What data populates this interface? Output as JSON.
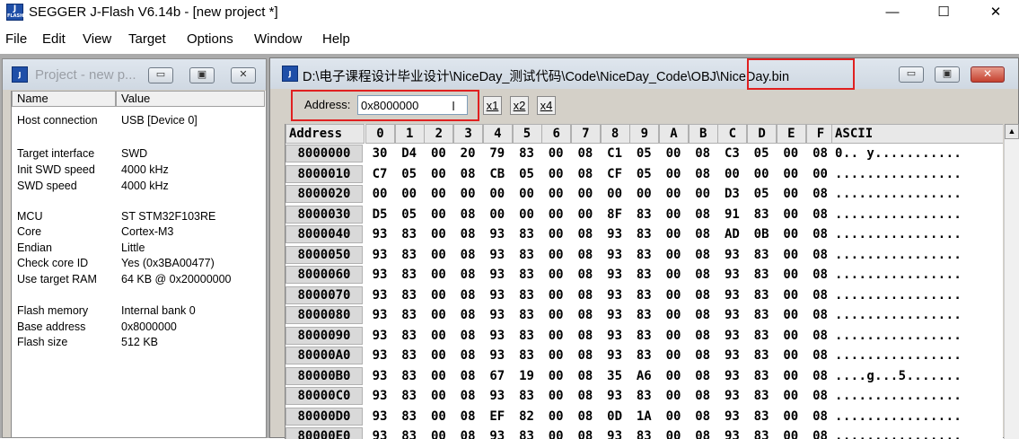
{
  "window": {
    "title": "SEGGER J-Flash V6.14b - [new project *]",
    "icon_text": "J",
    "icon_sub": "FLASH",
    "minimize": "—",
    "maximize": "☐",
    "close": "✕"
  },
  "menu": [
    "File",
    "Edit",
    "View",
    "Target",
    "Options",
    "Window",
    "Help"
  ],
  "project": {
    "title": "Project - new p...",
    "headers": {
      "name": "Name",
      "value": "Value"
    },
    "rows": [
      {
        "name": "Host connection",
        "value": "USB [Device 0]"
      },
      {
        "name": "Target interface",
        "value": "SWD"
      },
      {
        "name": "Init SWD speed",
        "value": "4000 kHz"
      },
      {
        "name": "SWD speed",
        "value": "4000 kHz"
      },
      {
        "name": "MCU",
        "value": "ST STM32F103RE"
      },
      {
        "name": "Core",
        "value": "Cortex-M3"
      },
      {
        "name": "Endian",
        "value": "Little"
      },
      {
        "name": "Check core ID",
        "value": "Yes (0x3BA00477)"
      },
      {
        "name": "Use target RAM",
        "value": "64 KB @ 0x20000000"
      },
      {
        "name": "Flash memory",
        "value": "Internal bank 0"
      },
      {
        "name": "Base address",
        "value": "0x8000000"
      },
      {
        "name": "Flash size",
        "value": "512 KB"
      }
    ]
  },
  "hexview": {
    "path_prefix": "D:\\电子课程设计毕业设计\\NiceDay_测试代码\\Code\\NiceDay_Code\\OBJ\\",
    "file_name": "NiceDay.bin",
    "address_label": "Address:",
    "address_value": "0x8000000",
    "zoom": [
      "x1",
      "x2",
      "x4"
    ],
    "columns": {
      "address": "Address",
      "bytes": [
        "0",
        "1",
        "2",
        "3",
        "4",
        "5",
        "6",
        "7",
        "8",
        "9",
        "A",
        "B",
        "C",
        "D",
        "E",
        "F"
      ],
      "ascii": "ASCII"
    },
    "rows": [
      {
        "addr": "8000000",
        "bytes": [
          "30",
          "D4",
          "00",
          "20",
          "79",
          "83",
          "00",
          "08",
          "C1",
          "05",
          "00",
          "08",
          "C3",
          "05",
          "00",
          "08"
        ],
        "ascii": "0.. y..........."
      },
      {
        "addr": "8000010",
        "bytes": [
          "C7",
          "05",
          "00",
          "08",
          "CB",
          "05",
          "00",
          "08",
          "CF",
          "05",
          "00",
          "08",
          "00",
          "00",
          "00",
          "00"
        ],
        "ascii": "................"
      },
      {
        "addr": "8000020",
        "bytes": [
          "00",
          "00",
          "00",
          "00",
          "00",
          "00",
          "00",
          "00",
          "00",
          "00",
          "00",
          "00",
          "D3",
          "05",
          "00",
          "08"
        ],
        "ascii": "................"
      },
      {
        "addr": "8000030",
        "bytes": [
          "D5",
          "05",
          "00",
          "08",
          "00",
          "00",
          "00",
          "00",
          "8F",
          "83",
          "00",
          "08",
          "91",
          "83",
          "00",
          "08"
        ],
        "ascii": "................"
      },
      {
        "addr": "8000040",
        "bytes": [
          "93",
          "83",
          "00",
          "08",
          "93",
          "83",
          "00",
          "08",
          "93",
          "83",
          "00",
          "08",
          "AD",
          "0B",
          "00",
          "08"
        ],
        "ascii": "................"
      },
      {
        "addr": "8000050",
        "bytes": [
          "93",
          "83",
          "00",
          "08",
          "93",
          "83",
          "00",
          "08",
          "93",
          "83",
          "00",
          "08",
          "93",
          "83",
          "00",
          "08"
        ],
        "ascii": "................"
      },
      {
        "addr": "8000060",
        "bytes": [
          "93",
          "83",
          "00",
          "08",
          "93",
          "83",
          "00",
          "08",
          "93",
          "83",
          "00",
          "08",
          "93",
          "83",
          "00",
          "08"
        ],
        "ascii": "................"
      },
      {
        "addr": "8000070",
        "bytes": [
          "93",
          "83",
          "00",
          "08",
          "93",
          "83",
          "00",
          "08",
          "93",
          "83",
          "00",
          "08",
          "93",
          "83",
          "00",
          "08"
        ],
        "ascii": "................"
      },
      {
        "addr": "8000080",
        "bytes": [
          "93",
          "83",
          "00",
          "08",
          "93",
          "83",
          "00",
          "08",
          "93",
          "83",
          "00",
          "08",
          "93",
          "83",
          "00",
          "08"
        ],
        "ascii": "................"
      },
      {
        "addr": "8000090",
        "bytes": [
          "93",
          "83",
          "00",
          "08",
          "93",
          "83",
          "00",
          "08",
          "93",
          "83",
          "00",
          "08",
          "93",
          "83",
          "00",
          "08"
        ],
        "ascii": "................"
      },
      {
        "addr": "80000A0",
        "bytes": [
          "93",
          "83",
          "00",
          "08",
          "93",
          "83",
          "00",
          "08",
          "93",
          "83",
          "00",
          "08",
          "93",
          "83",
          "00",
          "08"
        ],
        "ascii": "................"
      },
      {
        "addr": "80000B0",
        "bytes": [
          "93",
          "83",
          "00",
          "08",
          "67",
          "19",
          "00",
          "08",
          "35",
          "A6",
          "00",
          "08",
          "93",
          "83",
          "00",
          "08"
        ],
        "ascii": "....g...5......."
      },
      {
        "addr": "80000C0",
        "bytes": [
          "93",
          "83",
          "00",
          "08",
          "93",
          "83",
          "00",
          "08",
          "93",
          "83",
          "00",
          "08",
          "93",
          "83",
          "00",
          "08"
        ],
        "ascii": "................"
      },
      {
        "addr": "80000D0",
        "bytes": [
          "93",
          "83",
          "00",
          "08",
          "EF",
          "82",
          "00",
          "08",
          "0D",
          "1A",
          "00",
          "08",
          "93",
          "83",
          "00",
          "08"
        ],
        "ascii": "................"
      },
      {
        "addr": "80000E0",
        "bytes": [
          "93",
          "83",
          "00",
          "08",
          "93",
          "83",
          "00",
          "08",
          "93",
          "83",
          "00",
          "08",
          "93",
          "83",
          "00",
          "08"
        ],
        "ascii": "................"
      }
    ]
  }
}
